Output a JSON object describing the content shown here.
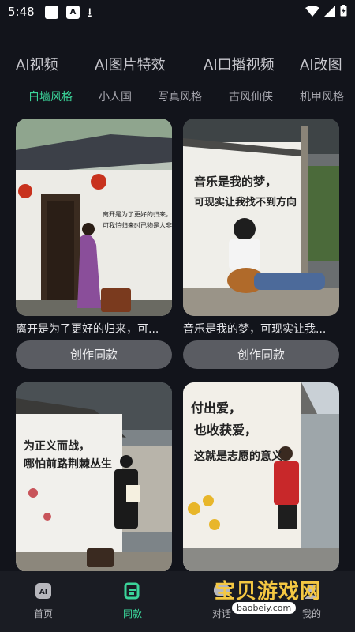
{
  "status": {
    "time": "5:48",
    "badge": "A"
  },
  "category_tabs": [
    "AI视频",
    "AI图片特效",
    "AI口播视频",
    "AI改图"
  ],
  "style_tabs": [
    "白墙风格",
    "小人国",
    "写真风格",
    "古风仙侠",
    "机甲风格"
  ],
  "cards": [
    {
      "caption": "离开是为了更好的归来，可...",
      "button": "创作同款",
      "mural": [
        "离开是为了更好的归来，",
        "可我怕归来时已物是人非"
      ]
    },
    {
      "caption": "音乐是我的梦，可现实让我...",
      "button": "创作同款",
      "mural": [
        "音乐是我的梦，",
        "可现实让我找不到方向"
      ]
    },
    {
      "mural": [
        "为正义而战，",
        "哪怕前路荆棘丛生"
      ]
    },
    {
      "mural": [
        "付出爱，",
        "也收获爱，",
        "这就是志愿的意义"
      ]
    }
  ],
  "bottom_nav": [
    {
      "label": "首页",
      "icon": "ai-home-icon"
    },
    {
      "label": "同款",
      "icon": "template-icon"
    },
    {
      "label": "对话",
      "icon": "chat-icon"
    },
    {
      "label": "我的",
      "icon": "profile-icon"
    }
  ],
  "watermark": {
    "text": "宝贝游戏网",
    "url": "baobeiy.com"
  },
  "colors": {
    "accent": "#3bd59a",
    "background": "#12141b"
  }
}
